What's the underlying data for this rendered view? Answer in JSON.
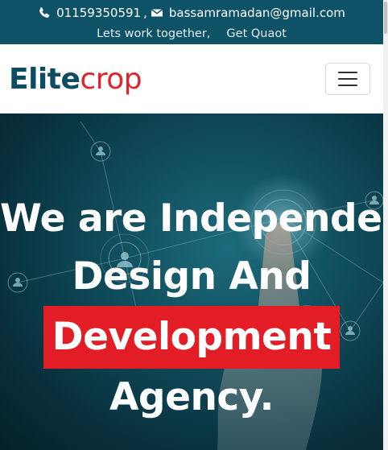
{
  "topbar": {
    "phone": "01159350591",
    "separator": ",",
    "email": "bassamramadan@gmail.com",
    "tagline": "Lets work together,",
    "cta": "Get Quaot",
    "phone_icon": "phone-icon",
    "email_icon": "envelope-icon"
  },
  "navbar": {
    "brand_part1": "Elite",
    "brand_part2": "crop",
    "menu_icon": "hamburger-menu-icon"
  },
  "hero": {
    "line1": "We are Independent",
    "line2": "Design And",
    "highlight": "Development",
    "line4": "Agency."
  },
  "colors": {
    "topbar_bg": "#0d5266",
    "brand_primary": "#0d4c63",
    "brand_accent": "#e0242b",
    "highlight_bg": "#e31d25"
  }
}
